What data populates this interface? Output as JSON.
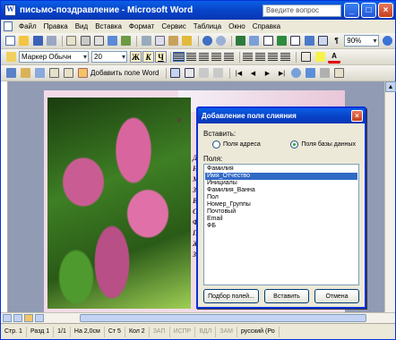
{
  "window": {
    "title": "письмо-поздравление - Microsoft Word",
    "help_placeholder": "Введите вопрос",
    "buttons": {
      "minimize": "_",
      "maximize": "□",
      "close": "×"
    }
  },
  "menubar": [
    "Файл",
    "Правка",
    "Вид",
    "Вставка",
    "Формат",
    "Сервис",
    "Таблица",
    "Окно",
    "Справка"
  ],
  "toolbar_format": {
    "style": "Маркер Обычн",
    "size": "20",
    "bold": "Ж",
    "italic": "К",
    "underline": "Ч",
    "zoom": "90%"
  },
  "toolbar_mailmerge": {
    "insert_merge_field": "Добавить поле Word"
  },
  "document": {
    "page_snippet": "К",
    "side_letters": [
      "Д",
      "Н",
      "М",
      "З",
      "В",
      "С",
      "Ф",
      "П",
      "Ж",
      "З"
    ]
  },
  "dialog": {
    "title": "Добавление поля слияния",
    "section_label": "Вставить:",
    "radio_address": "Поля адреса",
    "radio_database": "Поля базы данных",
    "fields_label": "Поля:",
    "fields": [
      "Фамилия",
      "Имя_Отчество",
      "Инициалы",
      "Фамилия_Ванна",
      "Пол",
      "Номер_Группы",
      "Почтовый",
      "Email",
      "ФБ"
    ],
    "selected_index": 1,
    "btn_match": "Подбор полей...",
    "btn_insert": "Вставить",
    "btn_cancel": "Отмена"
  },
  "statusbar": {
    "page": "Стр. 1",
    "section": "Разд 1",
    "pages": "1/1",
    "position": "На 2,0см",
    "line": "Ст 5",
    "col": "Кол 2",
    "rec": "ЗАП",
    "trk": "ИСПР",
    "ext": "ВДЛ",
    "ovr": "ЗАМ",
    "lang": "русский (Ро"
  }
}
